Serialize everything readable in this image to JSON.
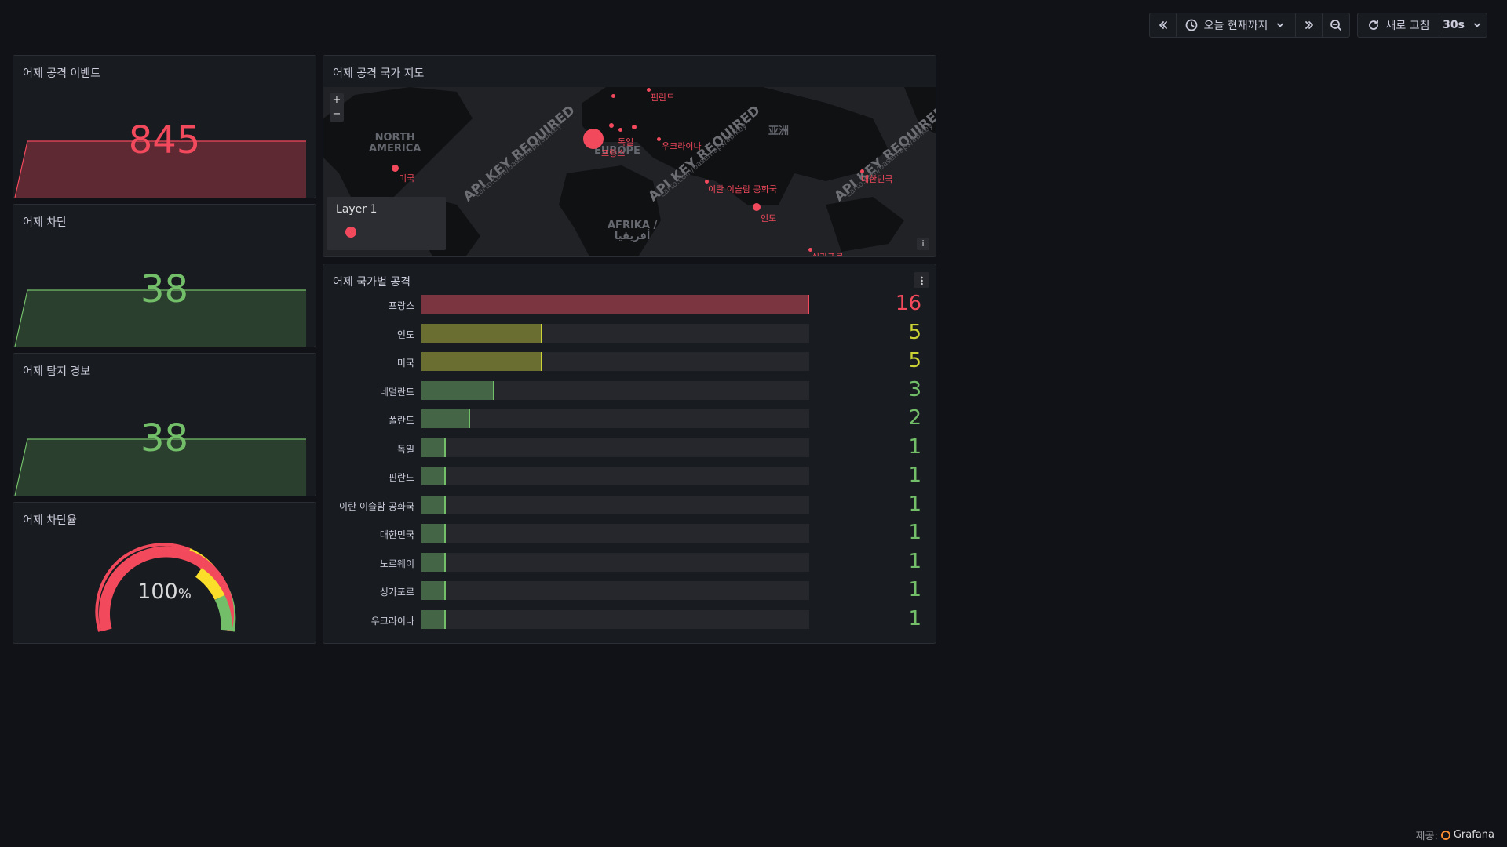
{
  "toolbar": {
    "time_range_label": "오늘 현재까지",
    "refresh_label": "새로 고침",
    "refresh_interval": "30s"
  },
  "panels": {
    "attack_events": {
      "title": "어제 공격 이벤트",
      "value": "845",
      "color": "#f2495c"
    },
    "blocked": {
      "title": "어제 차단",
      "value": "38",
      "color": "#73bf69"
    },
    "detect_alerts": {
      "title": "어제 탐지 경보",
      "value": "38",
      "color": "#73bf69"
    },
    "block_rate": {
      "title": "어제 차단율",
      "value": "100",
      "unit": "%"
    },
    "map": {
      "title": "어제 공격 국가 지도",
      "legend_title": "Layer 1",
      "zoom_in": "+",
      "zoom_out": "−",
      "info": "i",
      "watermark": "API KEY REQUIRED",
      "watermark_url": "carto.com/basemaps/apikey",
      "geo": [
        {
          "label": "NORTH\nAMERICA"
        },
        {
          "label": "EUROPE"
        },
        {
          "label": "AFRIKA /\nأفريقيا"
        },
        {
          "label": "亚洲"
        }
      ],
      "countries": [
        "핀란드",
        "독일",
        "프랑스",
        "우크라이나",
        "미국",
        "이란 이슬람 공화국",
        "인도",
        "대한민국",
        "싱가포르"
      ]
    },
    "by_country": {
      "title": "어제 국가별 공격"
    }
  },
  "chart_data": {
    "type": "bar",
    "orientation": "horizontal",
    "categories": [
      "프랑스",
      "인도",
      "미국",
      "네덜란드",
      "폴란드",
      "독일",
      "핀란드",
      "이란 이슬람 공화국",
      "대한민국",
      "노르웨이",
      "싱가포르",
      "우크라이나"
    ],
    "values": [
      16,
      5,
      5,
      3,
      2,
      1,
      1,
      1,
      1,
      1,
      1,
      1
    ],
    "xlim": [
      0,
      16
    ],
    "colors": {
      "high": "#f2495c",
      "mid": "#cad234",
      "low": "#73bf69"
    }
  },
  "footer": {
    "prefix": "제공:",
    "brand": "Grafana"
  }
}
